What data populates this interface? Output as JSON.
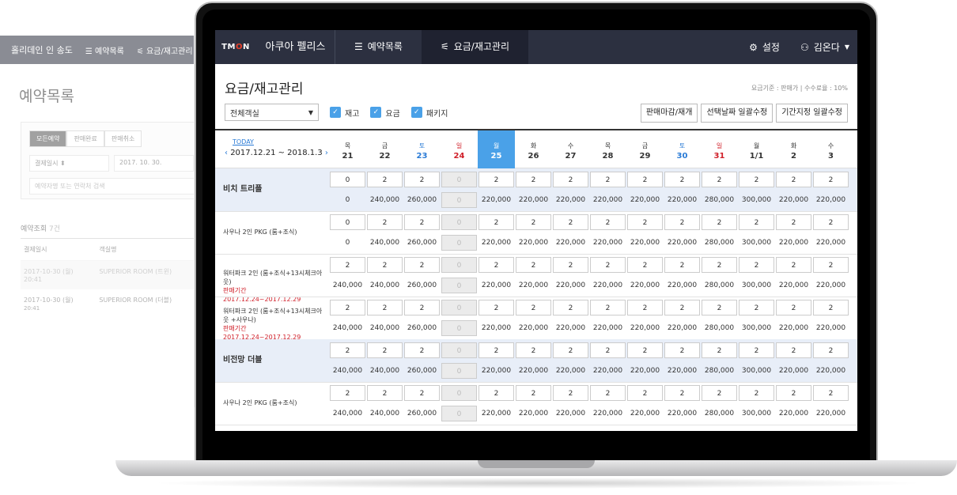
{
  "bg": {
    "hotel": "홀리데인 인 송도",
    "menu1": "예약목록",
    "menu2": "요금/재고관리",
    "title": "예약목록",
    "tabs": [
      "모든예약",
      "판매완료",
      "판매취소"
    ],
    "date_select": "결제일시",
    "date_value": "2017. 10. 30.",
    "search_placeholder": "예약자명 또는 연락처 검색",
    "count_label": "예약조회",
    "count_value": "7건",
    "col1": "결제일시",
    "col2": "객실명",
    "rows": [
      {
        "date": "2017-10-30 (월)",
        "time": "20:41",
        "room": "SUPERIOR ROOM (트윈)"
      },
      {
        "date": "2017-10-30 (월)",
        "time": "20:41",
        "room": "SUPERIOR ROOM (더블)"
      }
    ]
  },
  "nav": {
    "logo_a": "TM",
    "logo_b": "O",
    "logo_c": "N",
    "hotel": "아쿠아 펠리스",
    "menu_reservations": "예약목록",
    "menu_rates": "요금/재고관리",
    "settings": "설정",
    "user": "김온다"
  },
  "page": {
    "title": "요금/재고관리",
    "info": "요금기준 : 판매가  |  수수료율 : 10%",
    "room_select": "전체객실",
    "check_stock": "재고",
    "check_price": "요금",
    "check_package": "패키지",
    "btn_close": "판매마감/재개",
    "btn_select": "선택날짜 일괄수정",
    "btn_period": "기간지정 일괄수정",
    "today": "TODAY",
    "range": "2017.12.21 ~ 2018.1.3"
  },
  "dates": [
    {
      "w": "목",
      "d": "21",
      "t": ""
    },
    {
      "w": "금",
      "d": "22",
      "t": ""
    },
    {
      "w": "토",
      "d": "23",
      "t": "sat"
    },
    {
      "w": "일",
      "d": "24",
      "t": "sun"
    },
    {
      "w": "월",
      "d": "25",
      "t": "sel"
    },
    {
      "w": "화",
      "d": "26",
      "t": ""
    },
    {
      "w": "수",
      "d": "27",
      "t": ""
    },
    {
      "w": "목",
      "d": "28",
      "t": ""
    },
    {
      "w": "금",
      "d": "29",
      "t": ""
    },
    {
      "w": "토",
      "d": "30",
      "t": "sat"
    },
    {
      "w": "일",
      "d": "31",
      "t": "sun"
    },
    {
      "w": "월",
      "d": "1/1",
      "t": ""
    },
    {
      "w": "화",
      "d": "2",
      "t": ""
    },
    {
      "w": "수",
      "d": "3",
      "t": ""
    }
  ],
  "rooms": [
    {
      "name": "비치 트리플",
      "big": true,
      "hl": true,
      "period": "",
      "stock": [
        "0",
        "2",
        "2",
        "0",
        "2",
        "2",
        "2",
        "2",
        "2",
        "2",
        "2",
        "2",
        "2",
        "2"
      ],
      "price": [
        "0",
        "240,000",
        "260,000",
        "0",
        "220,000",
        "220,000",
        "220,000",
        "220,000",
        "220,000",
        "220,000",
        "280,000",
        "300,000",
        "220,000",
        "220,000"
      ]
    },
    {
      "name": "사우나 2인 PKG (룸+조식)",
      "big": false,
      "hl": false,
      "period": "",
      "stock": [
        "0",
        "2",
        "2",
        "0",
        "2",
        "2",
        "2",
        "2",
        "2",
        "2",
        "2",
        "2",
        "2",
        "2"
      ],
      "price": [
        "0",
        "240,000",
        "260,000",
        "0",
        "220,000",
        "220,000",
        "220,000",
        "220,000",
        "220,000",
        "220,000",
        "280,000",
        "300,000",
        "220,000",
        "220,000"
      ]
    },
    {
      "name": "워터파크 2인 (룸+조식+13시체크아웃)",
      "big": false,
      "hl": false,
      "period": "판매기간 2017.12.24~2017.12.29",
      "stock": [
        "2",
        "2",
        "2",
        "0",
        "2",
        "2",
        "2",
        "2",
        "2",
        "2",
        "2",
        "2",
        "2",
        "2"
      ],
      "price": [
        "240,000",
        "240,000",
        "260,000",
        "0",
        "220,000",
        "220,000",
        "220,000",
        "220,000",
        "220,000",
        "220,000",
        "280,000",
        "300,000",
        "220,000",
        "220,000"
      ]
    },
    {
      "name": "워터파크 2인 (룸+조식+13시체크아웃 +사우나)",
      "big": false,
      "hl": false,
      "period": "판매기간 2017.12.24~2017.12.29",
      "stock": [
        "2",
        "2",
        "2",
        "0",
        "2",
        "2",
        "2",
        "2",
        "2",
        "2",
        "2",
        "2",
        "2",
        "2"
      ],
      "price": [
        "240,000",
        "240,000",
        "260,000",
        "0",
        "220,000",
        "220,000",
        "220,000",
        "220,000",
        "220,000",
        "220,000",
        "280,000",
        "300,000",
        "220,000",
        "220,000"
      ]
    },
    {
      "name": "비전망 더블",
      "big": true,
      "hl": true,
      "period": "",
      "stock": [
        "2",
        "2",
        "2",
        "0",
        "2",
        "2",
        "2",
        "2",
        "2",
        "2",
        "2",
        "2",
        "2",
        "2"
      ],
      "price": [
        "240,000",
        "240,000",
        "260,000",
        "0",
        "220,000",
        "220,000",
        "220,000",
        "220,000",
        "220,000",
        "220,000",
        "280,000",
        "300,000",
        "220,000",
        "220,000"
      ]
    },
    {
      "name": "사우나 2인 PKG (룸+조식)",
      "big": false,
      "hl": false,
      "period": "",
      "stock": [
        "2",
        "2",
        "2",
        "0",
        "2",
        "2",
        "2",
        "2",
        "2",
        "2",
        "2",
        "2",
        "2",
        "2"
      ],
      "price": [
        "240,000",
        "240,000",
        "260,000",
        "0",
        "220,000",
        "220,000",
        "220,000",
        "220,000",
        "220,000",
        "220,000",
        "280,000",
        "300,000",
        "220,000",
        "220,000"
      ]
    }
  ],
  "disabled_col": 3,
  "first_col_cell_only_rows": [
    0,
    1
  ]
}
